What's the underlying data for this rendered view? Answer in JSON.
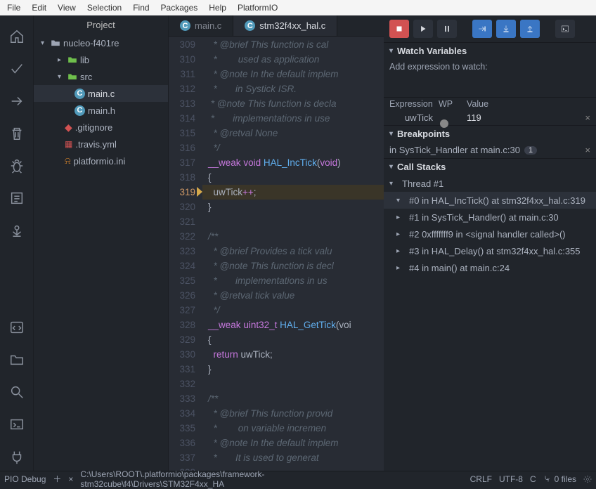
{
  "menubar": [
    "File",
    "Edit",
    "View",
    "Selection",
    "Find",
    "Packages",
    "Help",
    "PlatformIO"
  ],
  "sidebar_title": "Project",
  "tree": {
    "root": "nucleo-f401re",
    "lib": "lib",
    "src": "src",
    "mainc": "main.c",
    "mainh": "main.h",
    "gitignore": ".gitignore",
    "travis": ".travis.yml",
    "pio": "platformio.ini"
  },
  "tabs": {
    "t1": "main.c",
    "t2": "stm32f4xx_hal.c"
  },
  "code": {
    "start": 309,
    "lines": [
      "  * @brief This function is cal",
      "  *        used as application ",
      "  * @note In the default implem",
      "  *       in Systick ISR.",
      " * @note This function is decla",
      " *       implementations in use",
      "  * @retval None",
      "  */",
      "__weak void HAL_IncTick(void)",
      "{",
      "  uwTick++;",
      "}",
      "",
      "/**",
      "  * @brief Provides a tick valu",
      "  * @note This function is decl",
      "  *       implementations in us",
      "  * @retval tick value",
      "  */",
      "__weak uint32_t HAL_GetTick(voi",
      "{",
      "  return uwTick;",
      "}",
      "",
      "/**",
      "  * @brief This function provid",
      "  *        on variable incremen",
      "  * @note In the default implem",
      "  *       It is used to generat",
      ""
    ],
    "highlight_line": 319
  },
  "debug": {
    "watch_title": "Watch Variables",
    "watch_add": "Add expression to watch:",
    "hdr_expr": "Expression",
    "hdr_wp": "WP",
    "hdr_val": "Value",
    "var_name": "uwTick",
    "var_val": "119",
    "bp_title": "Breakpoints",
    "bp_row": "in SysTick_Handler at main.c:30",
    "bp_count": "1",
    "cs_title": "Call Stacks",
    "thread": "Thread #1",
    "stack": [
      "#0 in HAL_IncTick() at stm32f4xx_hal.c:319",
      "#1 in SysTick_Handler() at main.c:30",
      "#2 0xfffffff9 in <signal handler called>()",
      "#3 in HAL_Delay() at stm32f4xx_hal.c:355",
      "#4 in main() at main.c:24"
    ]
  },
  "status": {
    "mode": "PIO Debug",
    "path": "C:\\Users\\ROOT\\.platformio\\packages\\framework-stm32cube\\f4\\Drivers\\STM32F4xx_HA",
    "eol": "CRLF",
    "enc": "UTF-8",
    "lang": "C",
    "files": "0 files"
  }
}
